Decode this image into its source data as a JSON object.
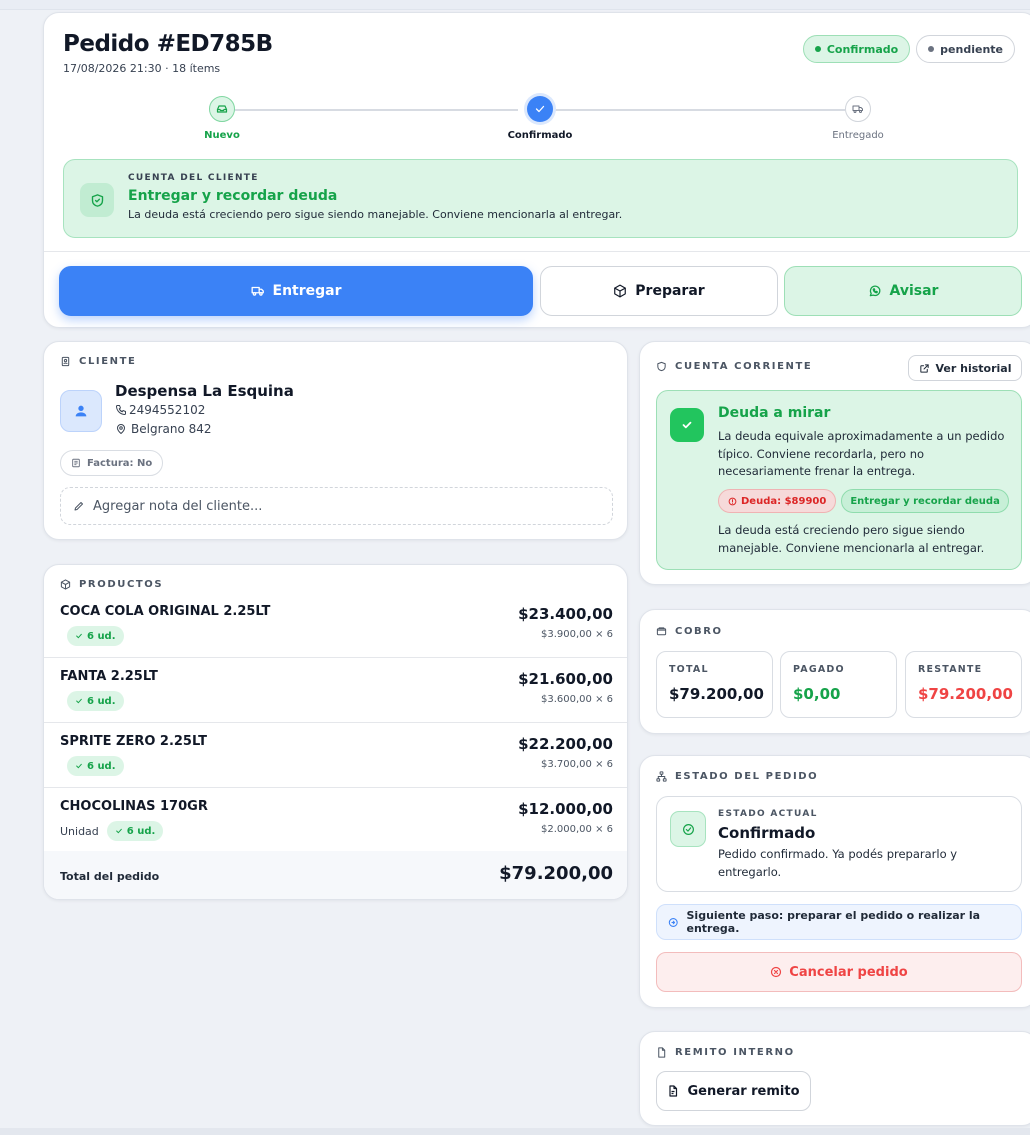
{
  "colors": {
    "accent_blue": "#3b82f6",
    "success_green": "#16a34a",
    "danger_red": "#ef4444",
    "page_bg": "#eef1f6"
  },
  "order": {
    "title": "Pedido #ED785B",
    "meta": "17/08/2026 21:30 · 18 ítems",
    "badges": [
      {
        "label": "Confirmado",
        "tone": "green"
      },
      {
        "label": "pendiente",
        "tone": "gray"
      }
    ]
  },
  "stepper": {
    "steps": [
      {
        "label": "Nuevo",
        "icon": "inbox-icon",
        "state": "done"
      },
      {
        "label": "Confirmado",
        "icon": "check-icon",
        "state": "current"
      },
      {
        "label": "Entregado",
        "icon": "truck-icon",
        "state": "upcoming"
      }
    ]
  },
  "account_alert": {
    "kicker": "CUENTA DEL CLIENTE",
    "title": "Entregar y recordar deuda",
    "text": "La deuda está creciendo pero sigue siendo manejable. Conviene mencionarla al entregar.",
    "icon": "shield-icon"
  },
  "actions": {
    "deliver": "Entregar",
    "prepare": "Preparar",
    "notify": "Avisar"
  },
  "client": {
    "section_label": "CLIENTE",
    "name": "Despensa La Esquina",
    "phone": "2494552102",
    "address": "Belgrano 842",
    "invoice_chip": "Factura: No",
    "note_placeholder": "Agregar nota del cliente..."
  },
  "products": {
    "section_label": "PRODUCTOS",
    "items": [
      {
        "name": "COCA COLA ORIGINAL 2.25LT",
        "unit_label": "",
        "qty": "6 ud.",
        "total": "$23.400,00",
        "unit_price": "$3.900,00 × 6"
      },
      {
        "name": "FANTA 2.25LT",
        "unit_label": "",
        "qty": "6 ud.",
        "total": "$21.600,00",
        "unit_price": "$3.600,00 × 6"
      },
      {
        "name": "SPRITE ZERO 2.25LT",
        "unit_label": "",
        "qty": "6 ud.",
        "total": "$22.200,00",
        "unit_price": "$3.700,00 × 6"
      },
      {
        "name": "CHOCOLINAS 170GR",
        "unit_label": "Unidad",
        "qty": "6 ud.",
        "total": "$12.000,00",
        "unit_price": "$2.000,00 × 6"
      }
    ],
    "footer_label": "Total del pedido",
    "footer_total": "$79.200,00"
  },
  "current_account": {
    "section_label": "CUENTA CORRIENTE",
    "history_button": "Ver historial",
    "status_title": "Deuda a mirar",
    "status_text": "La deuda equivale aproximadamente a un pedido típico. Conviene recordarla, pero no necesariamente frenar la entrega.",
    "debt_chip": "Deuda: $89900",
    "action_chip": "Entregar y recordar deuda",
    "footer_text": "La deuda está creciendo pero sigue siendo manejable. Conviene mencionarla al entregar."
  },
  "billing": {
    "section_label": "COBRO",
    "total_label": "TOTAL",
    "total_value": "$79.200,00",
    "paid_label": "PAGADO",
    "paid_value": "$0,00",
    "remaining_label": "RESTANTE",
    "remaining_value": "$79.200,00"
  },
  "order_status": {
    "section_label": "ESTADO DEL PEDIDO",
    "kicker": "ESTADO ACTUAL",
    "title": "Confirmado",
    "text": "Pedido confirmado. Ya podés prepararlo y entregarlo.",
    "next_step": "Siguiente paso: preparar el pedido o realizar la entrega.",
    "cancel_button": "Cancelar pedido"
  },
  "internal_slip": {
    "section_label": "REMITO INTERNO",
    "button": "Generar remito"
  }
}
